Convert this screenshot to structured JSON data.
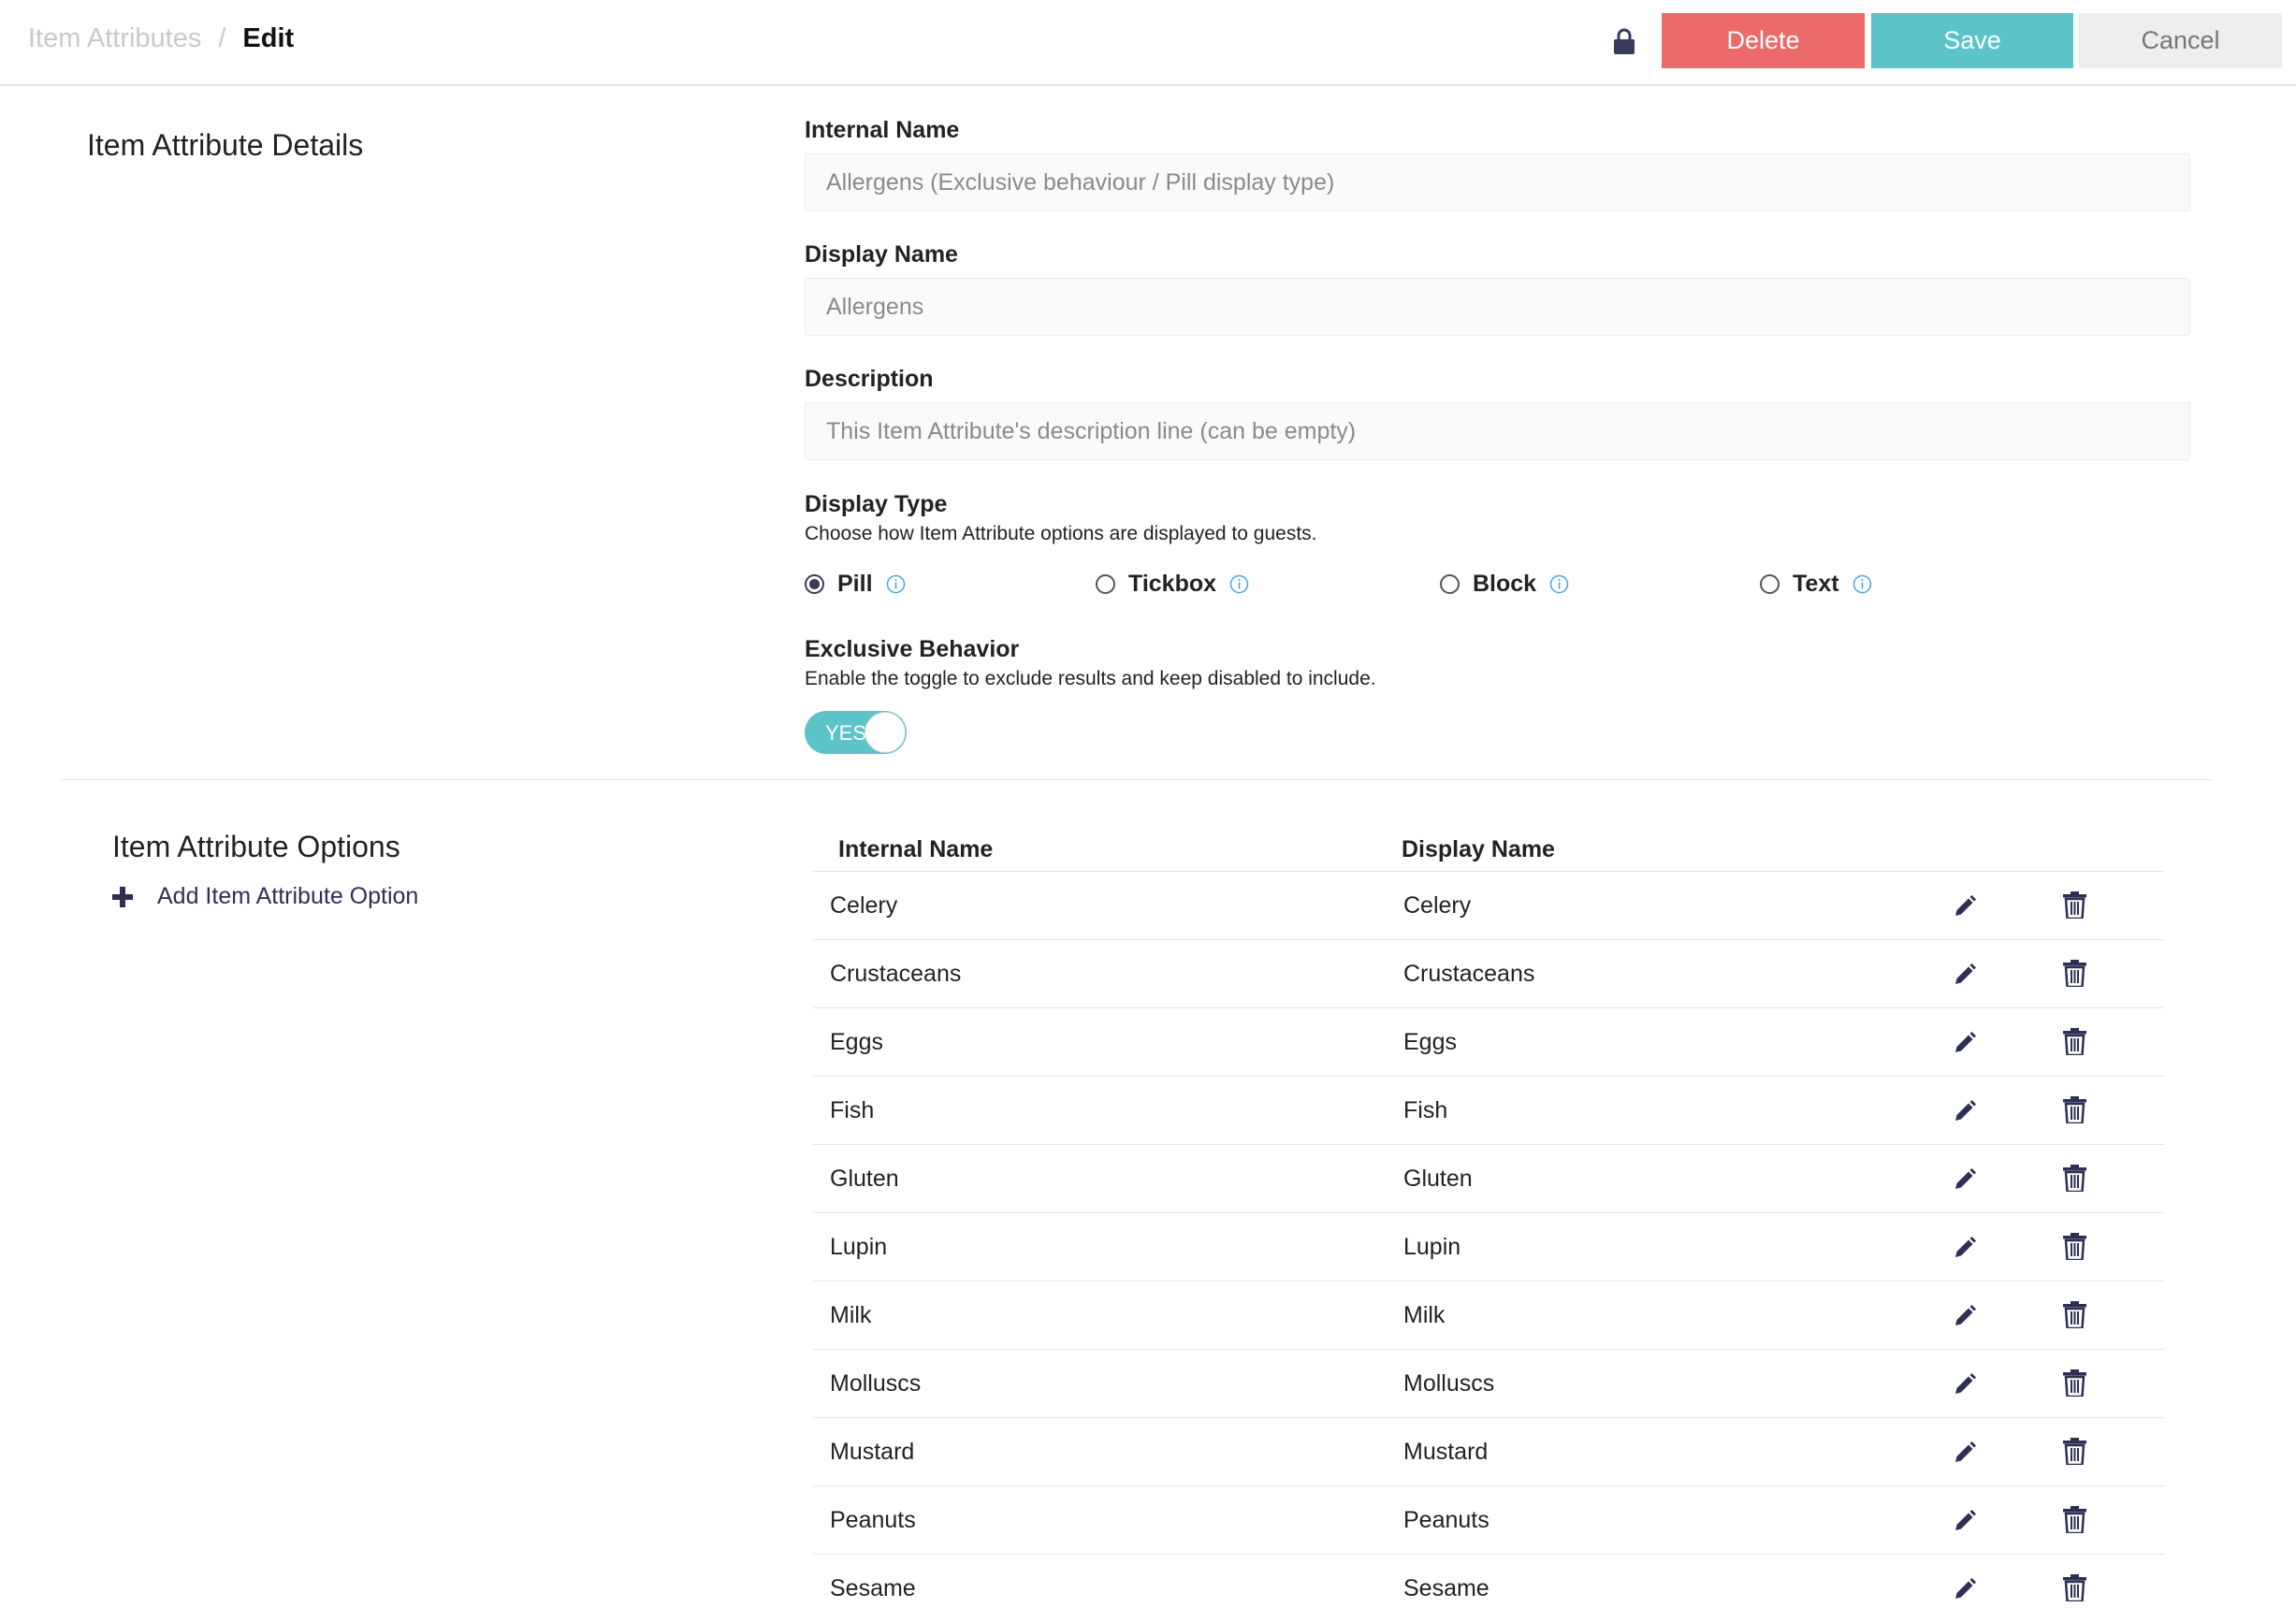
{
  "header": {
    "breadcrumb_parent": "Item Attributes",
    "breadcrumb_separator": "/",
    "breadcrumb_current": "Edit",
    "delete_label": "Delete",
    "save_label": "Save",
    "cancel_label": "Cancel"
  },
  "details": {
    "title": "Item Attribute Details",
    "internal_name": {
      "label": "Internal Name",
      "value": "Allergens (Exclusive behaviour / Pill display type)"
    },
    "display_name": {
      "label": "Display Name",
      "value": "Allergens"
    },
    "description": {
      "label": "Description",
      "placeholder": "This Item Attribute's description line (can be empty)"
    },
    "display_type": {
      "label": "Display Type",
      "help": "Choose how Item Attribute options are displayed to guests.",
      "options": [
        "Pill",
        "Tickbox",
        "Block",
        "Text"
      ],
      "selected": "Pill"
    },
    "exclusive": {
      "label": "Exclusive Behavior",
      "help": "Enable the toggle to exclude results and keep disabled to include.",
      "toggle_text": "YES",
      "enabled": true
    }
  },
  "options": {
    "title": "Item Attribute Options",
    "add_label": "Add Item Attribute Option",
    "columns": [
      "Internal Name",
      "Display Name"
    ],
    "rows": [
      {
        "internal": "Celery",
        "display": "Celery"
      },
      {
        "internal": "Crustaceans",
        "display": "Crustaceans"
      },
      {
        "internal": "Eggs",
        "display": "Eggs"
      },
      {
        "internal": "Fish",
        "display": "Fish"
      },
      {
        "internal": "Gluten",
        "display": "Gluten"
      },
      {
        "internal": "Lupin",
        "display": "Lupin"
      },
      {
        "internal": "Milk",
        "display": "Milk"
      },
      {
        "internal": "Molluscs",
        "display": "Molluscs"
      },
      {
        "internal": "Mustard",
        "display": "Mustard"
      },
      {
        "internal": "Peanuts",
        "display": "Peanuts"
      },
      {
        "internal": "Sesame",
        "display": "Sesame"
      }
    ]
  },
  "colors": {
    "accent": "#5cc4c8",
    "danger": "#ed6a6a",
    "icon": "#2f2f55"
  },
  "icons": {
    "lock": "lock-icon",
    "info": "info-icon",
    "plus": "plus-icon",
    "edit": "pencil-icon",
    "delete": "trash-icon"
  }
}
